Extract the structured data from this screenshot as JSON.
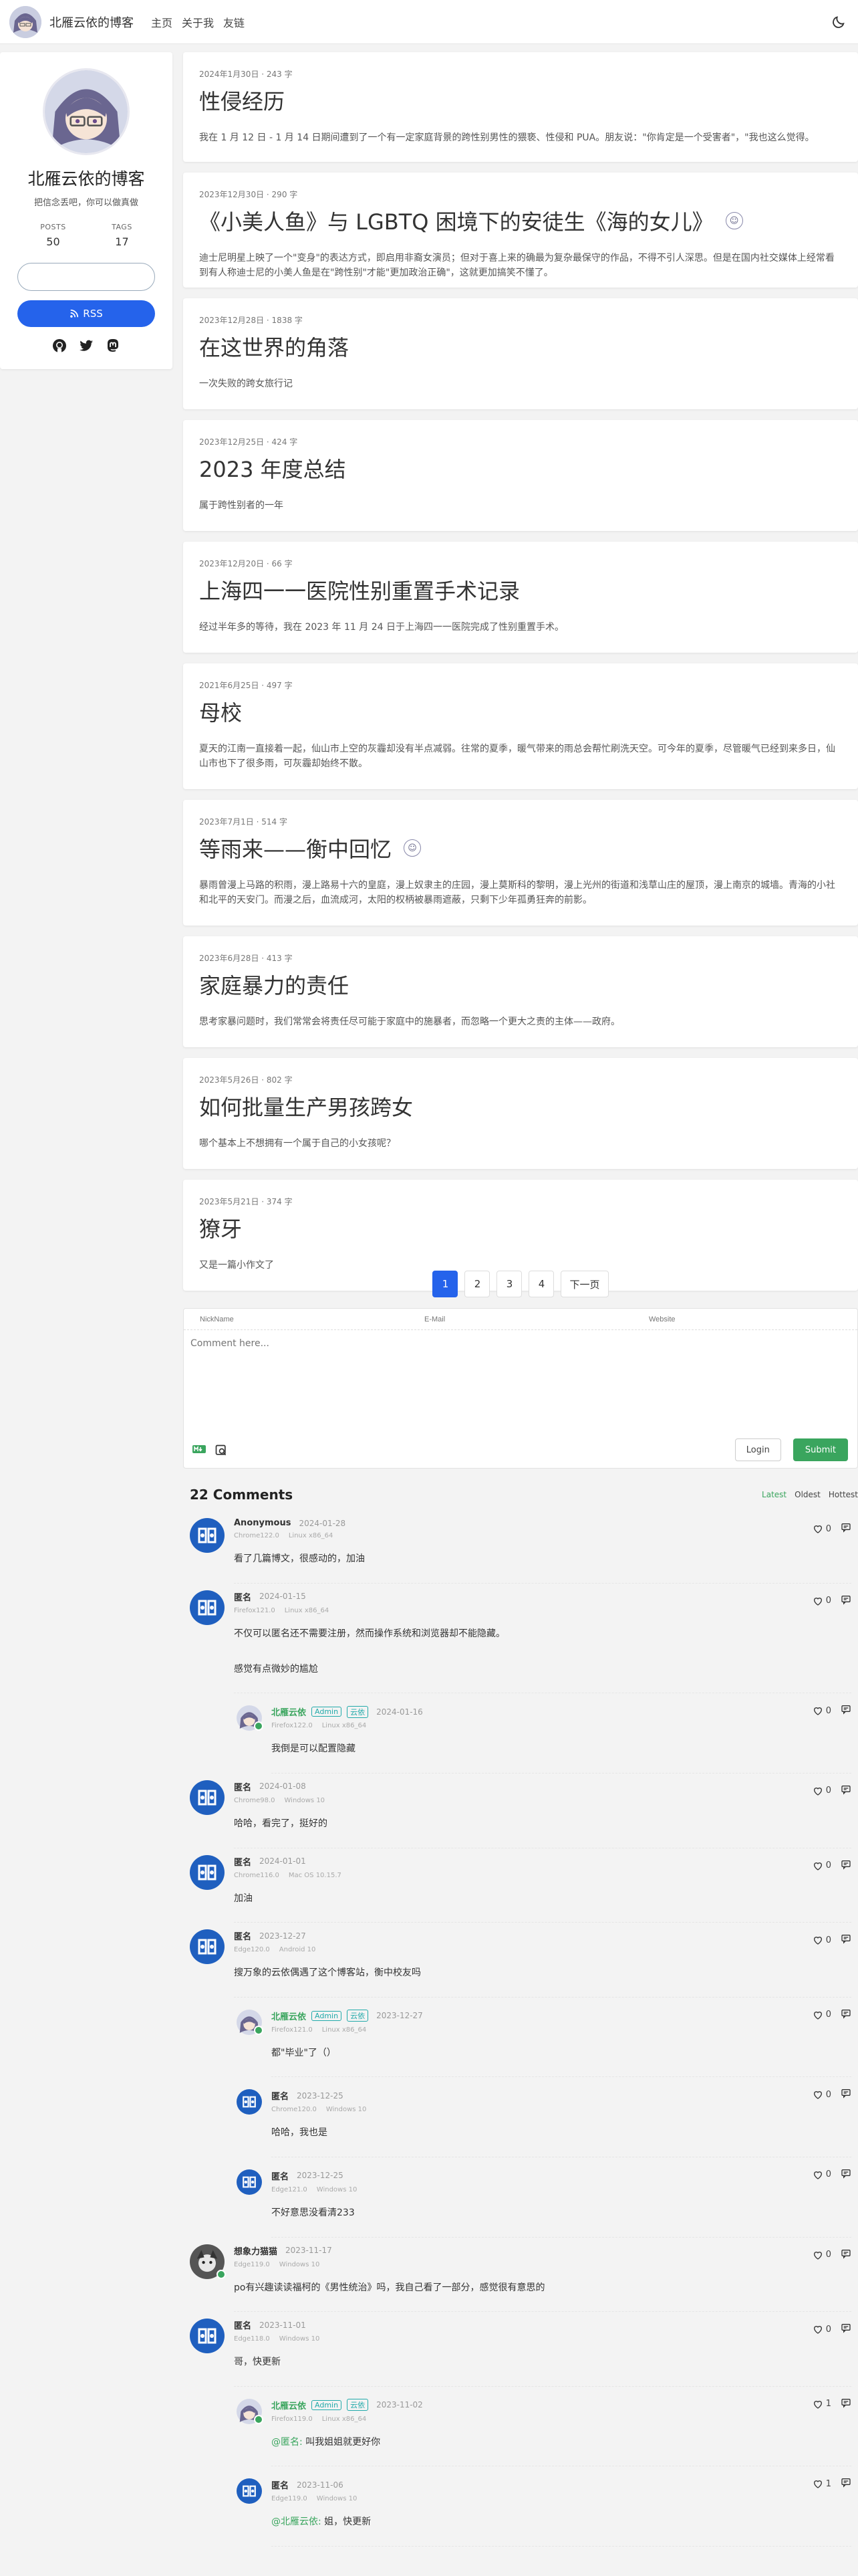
{
  "header": {
    "site_title": "北雁云依的博客",
    "nav": [
      "主页",
      "关于我",
      "友链"
    ]
  },
  "sidebar": {
    "title": "北雁云依的博客",
    "subtitle": "把信念丢吧，你可以做真做",
    "posts_label": "POSTS",
    "posts_count": "50",
    "tags_label": "TAGS",
    "tags_count": "17",
    "search_placeholder": "",
    "rss_label": "RSS"
  },
  "posts": [
    {
      "date": "2024年1月30日",
      "words": "243 字",
      "title": "性侵经历",
      "excerpt": "我在 1 月 12 日 - 1 月 14 日期间遭到了一个有一定家庭背景的跨性别男性的猥亵、性侵和 PUA。朋友说：\"你肯定是一个受害者\"，\"我也这么觉得。",
      "tag": false
    },
    {
      "date": "2023年12月30日",
      "words": "290 字",
      "title": "《小美人鱼》与 LGBTQ 困境下的安徒生《海的女儿》",
      "excerpt": "迪士尼明星上映了一个\"变身\"的表达方式，即启用非裔女演员；但对于喜上来的确最为复杂最保守的作品，不得不引人深思。但是在国内社交媒体上经常看到有人称迪士尼的小美人鱼是在\"跨性别\"才能\"更加政治正确\"，这就更加搞笑不懂了。",
      "tag": true
    },
    {
      "date": "2023年12月28日",
      "words": "1838 字",
      "title": "在这世界的角落",
      "excerpt": "一次失败的跨女旅行记",
      "tag": false
    },
    {
      "date": "2023年12月25日",
      "words": "424 字",
      "title": "2023 年度总结",
      "excerpt": "属于跨性别者的一年",
      "tag": false
    },
    {
      "date": "2023年12月20日",
      "words": "66 字",
      "title": "上海四一一医院性别重置手术记录",
      "excerpt": "经过半年多的等待，我在 2023 年 11 月 24 日于上海四一一医院完成了性别重置手术。",
      "tag": false
    },
    {
      "date": "2021年6月25日",
      "words": "497 字",
      "title": "母校",
      "excerpt": "夏天的江南一直接着一起，仙山市上空的灰霾却没有半点减弱。往常的夏季，暖气带来的雨总会帮忙刷洗天空。可今年的夏季，尽管暖气已经到来多日，仙山市也下了很多雨，可灰霾却始终不散。",
      "tag": false
    },
    {
      "date": "2023年7月1日",
      "words": "514 字",
      "title": "等雨来——衡中回忆",
      "excerpt": "暴雨曾漫上马路的积雨，漫上路易十六的皇庭，漫上奴隶主的庄园，漫上莫斯科的黎明，漫上光州的街道和浅草山庄的屋顶，漫上南京的城墙。青海的小社和北平的天安门。而漫之后，血流成河，太阳的权柄被暴雨遮蔽，只剩下少年孤勇狂奔的前影。",
      "tag": true
    },
    {
      "date": "2023年6月28日",
      "words": "413 字",
      "title": "家庭暴力的责任",
      "excerpt": "思考家暴问题时，我们常常会将责任尽可能于家庭中的施暴者，而忽略一个更大之责的主体——政府。",
      "tag": false
    },
    {
      "date": "2023年5月26日",
      "words": "802 字",
      "title": "如何批量生产男孩跨女",
      "excerpt": "哪个基本上不想拥有一个属于自己的小女孩呢？",
      "tag": false
    },
    {
      "date": "2023年5月21日",
      "words": "374 字",
      "title": "獠牙",
      "excerpt": "又是一篇小作文了",
      "tag": false
    }
  ],
  "pagination": {
    "pages": [
      "1",
      "2",
      "3",
      "4"
    ],
    "next": "下一页",
    "current": "1"
  },
  "editor": {
    "nick_placeholder": "NickName",
    "mail_placeholder": "E-Mail",
    "site_placeholder": "Website",
    "comment_placeholder": "Comment here...",
    "login_label": "Login",
    "submit_label": "Submit"
  },
  "comments_section": {
    "count": "22 Comments",
    "sort": [
      "Latest",
      "Oldest",
      "Hottest"
    ]
  },
  "comments": [
    {
      "nick": "Anonymous",
      "admin": false,
      "time": "2024-01-28",
      "browser": "Chrome122.0",
      "os": "Linux x86_64",
      "text": "看了几篇博文，很感动的，加油",
      "likes": "0",
      "avatar": "blue",
      "reply": false
    },
    {
      "nick": "匿名",
      "admin": false,
      "time": "2024-01-15",
      "browser": "Firefox121.0",
      "os": "Linux x86_64",
      "text": "不仅可以匿名还不需要注册，然而操作系统和浏览器却不能隐藏。\n\n感觉有点微妙的尴尬",
      "likes": "0",
      "avatar": "blue",
      "reply": false
    },
    {
      "nick": "北雁云依",
      "admin": true,
      "badge1": "Admin",
      "badge2": "云依",
      "time": "2024-01-16",
      "browser": "Firefox122.0",
      "os": "Linux x86_64",
      "text": "我倒是可以配置隐藏",
      "likes": "0",
      "avatar": "anime",
      "reply": true
    },
    {
      "nick": "匿名",
      "admin": false,
      "time": "2024-01-08",
      "browser": "Chrome98.0",
      "os": "Windows 10",
      "text": "哈哈，看完了，挺好的",
      "likes": "0",
      "avatar": "blue",
      "reply": false
    },
    {
      "nick": "匿名",
      "admin": false,
      "time": "2024-01-01",
      "browser": "Chrome116.0",
      "os": "Mac OS 10.15.7",
      "text": "加油",
      "likes": "0",
      "avatar": "blue",
      "reply": false
    },
    {
      "nick": "匿名",
      "admin": false,
      "time": "2023-12-27",
      "browser": "Edge120.0",
      "os": "Android 10",
      "text": "搜万象的云依偶遇了这个博客站，衡中校友吗",
      "likes": "0",
      "avatar": "blue",
      "reply": false
    },
    {
      "nick": "北雁云依",
      "admin": true,
      "badge1": "Admin",
      "badge2": "云依",
      "time": "2023-12-27",
      "browser": "Firefox121.0",
      "os": "Linux x86_64",
      "text": "都\"毕业\"了（）",
      "likes": "0",
      "avatar": "anime",
      "reply": true
    },
    {
      "nick": "匿名",
      "admin": false,
      "time": "2023-12-25",
      "browser": "Chrome120.0",
      "os": "Windows 10",
      "text": "哈哈，我也是",
      "likes": "0",
      "avatar": "blue",
      "reply": true
    },
    {
      "nick": "匿名",
      "admin": false,
      "time": "2023-12-25",
      "browser": "Edge121.0",
      "os": "Windows 10",
      "text": "不好意思没看清233",
      "likes": "0",
      "avatar": "blue",
      "reply": true
    },
    {
      "nick": "想象力猫猫",
      "admin": false,
      "time": "2023-11-17",
      "browser": "Edge119.0",
      "os": "Windows 10",
      "text": "po有兴趣读读福柯的《男性统治》吗，我自己看了一部分，感觉很有意思的",
      "likes": "0",
      "avatar": "gray",
      "reply": false
    },
    {
      "nick": "匿名",
      "admin": false,
      "time": "2023-11-01",
      "browser": "Edge118.0",
      "os": "Windows 10",
      "text": "哥，快更新",
      "likes": "0",
      "avatar": "blue",
      "reply": false
    },
    {
      "nick": "北雁云依",
      "admin": true,
      "badge1": "Admin",
      "badge2": "云依",
      "time": "2023-11-02",
      "browser": "Firefox119.0",
      "os": "Linux x86_64",
      "at": "@匿名:",
      "text": " 叫我姐姐就更好你",
      "likes": "1",
      "avatar": "anime",
      "reply": true
    },
    {
      "nick": "匿名",
      "admin": false,
      "time": "2023-11-06",
      "browser": "Edge119.0",
      "os": "Windows 10",
      "at": "@北雁云依:",
      "text": " 姐，快更新",
      "likes": "1",
      "avatar": "blue",
      "reply": true
    }
  ]
}
